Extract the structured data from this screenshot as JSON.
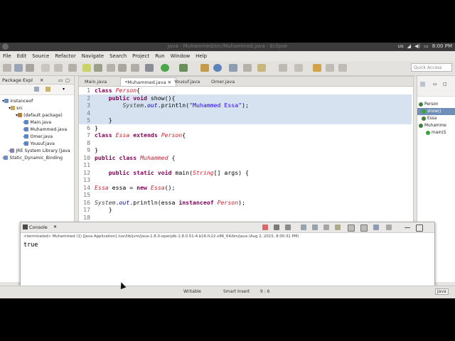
{
  "system_bar": {
    "window_title": "Java - Muhammed/src/Muhammed.java - Eclipse",
    "keyboard": "us",
    "time": "8:00 PM"
  },
  "menu": [
    "File",
    "Edit",
    "Source",
    "Refactor",
    "Navigate",
    "Search",
    "Project",
    "Run",
    "Window",
    "Help"
  ],
  "quick_access": {
    "placeholder": "Quick Access"
  },
  "package_explorer": {
    "title": "Package Expl",
    "tree": [
      {
        "label": "instanceof",
        "icon": "project-icon"
      },
      {
        "label": "src",
        "icon": "source-folder-icon"
      },
      {
        "label": "(default package)",
        "icon": "package-icon"
      },
      {
        "label": "Main.java",
        "icon": "java-file-icon"
      },
      {
        "label": "Muhammed.java",
        "icon": "java-file-icon"
      },
      {
        "label": "Omer.java",
        "icon": "java-file-icon"
      },
      {
        "label": "Yousuf.java",
        "icon": "java-file-icon"
      },
      {
        "label": "JRE System Library [Java",
        "icon": "library-icon"
      },
      {
        "label": "Static_Dynamic_Binding",
        "icon": "project-icon"
      }
    ]
  },
  "editor": {
    "tabs": [
      {
        "label": "Main.java",
        "active": false
      },
      {
        "label": "*Muhammed.java",
        "active": true
      },
      {
        "label": "Yousuf.java",
        "active": false
      },
      {
        "label": "Omer.java",
        "active": false
      }
    ],
    "lines": [
      {
        "n": "1",
        "text": "class Person{"
      },
      {
        "n": "2",
        "text": "    public void show(){"
      },
      {
        "n": "3",
        "text": "        System.out.println(\"Muhammed Essa\");"
      },
      {
        "n": "4",
        "text": ""
      },
      {
        "n": "5",
        "text": "    }"
      },
      {
        "n": "6",
        "text": "}"
      },
      {
        "n": "7",
        "text": "class Essa extends Person{"
      },
      {
        "n": "8",
        "text": ""
      },
      {
        "n": "9",
        "text": "}"
      },
      {
        "n": "10",
        "text": "public class Muhammed {"
      },
      {
        "n": "11",
        "text": ""
      },
      {
        "n": "12",
        "text": "    public static void main(String[] args) {"
      },
      {
        "n": "13",
        "text": ""
      },
      {
        "n": "14",
        "text": "Essa essa = new Essa();"
      },
      {
        "n": "15",
        "text": ""
      },
      {
        "n": "16",
        "text": "System.out.println(essa instanceof Person);"
      },
      {
        "n": "17",
        "text": "    }"
      },
      {
        "n": "18",
        "text": ""
      }
    ]
  },
  "outline": {
    "items": [
      "Person",
      "show()",
      "Essa",
      "Muhamme",
      "main(S"
    ]
  },
  "console": {
    "title": "Console",
    "terminated": "<terminated> Muhammed (1) [Java Application] /usr/lib/jvm/java-1.8.0-openjdk-1.8.0.51-4.b16.fc22.x86_64/bin/java (Aug 2, 2015, 8:00:31 PM)",
    "output": "true"
  },
  "status_bar": {
    "writable": "Writable",
    "insert": "Smart Insert",
    "position": "9 : 6",
    "perspective": "Java"
  },
  "colors": {
    "keyword": "#7f0055",
    "string": "#2a00ff",
    "current_line": "#d6e2f0"
  }
}
